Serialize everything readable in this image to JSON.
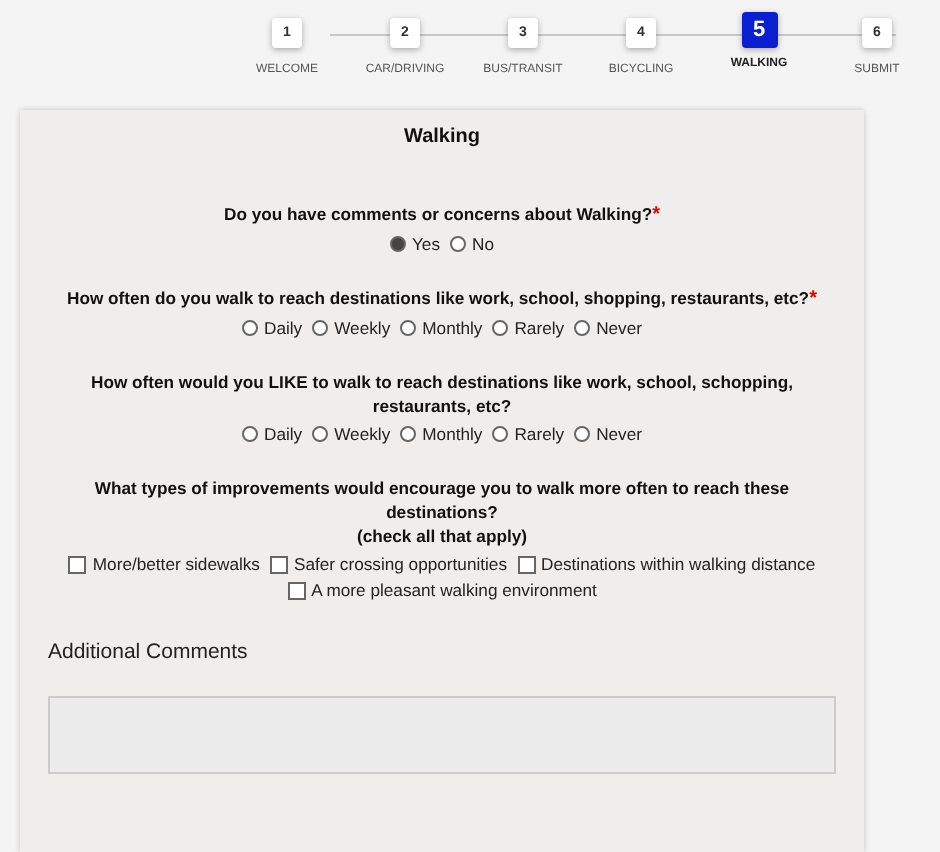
{
  "steps": [
    {
      "number": "1",
      "label": "WELCOME",
      "selected": false
    },
    {
      "number": "2",
      "label": "CAR/DRIVING",
      "selected": false
    },
    {
      "number": "3",
      "label": "BUS/TRANSIT",
      "selected": false
    },
    {
      "number": "4",
      "label": "BICYCLING",
      "selected": false
    },
    {
      "number": "5",
      "label": "WALKING",
      "selected": true
    },
    {
      "number": "6",
      "label": "SUBMIT",
      "selected": false
    }
  ],
  "form": {
    "title": "Walking",
    "questions": [
      {
        "kind": "radio",
        "label": "Do you have comments or concerns about Walking?",
        "required_mark": "*",
        "options": [
          {
            "label": "Yes",
            "selected": true
          },
          {
            "label": "No",
            "selected": false
          }
        ]
      },
      {
        "kind": "radio",
        "label": "How often do you walk to reach destinations like work, school, shopping, restaurants, etc?",
        "required_mark": "*",
        "options": [
          {
            "label": "Daily",
            "selected": false
          },
          {
            "label": "Weekly",
            "selected": false
          },
          {
            "label": "Monthly",
            "selected": false
          },
          {
            "label": "Rarely",
            "selected": false
          },
          {
            "label": "Never",
            "selected": false
          }
        ]
      },
      {
        "kind": "radio",
        "label": "How often would you LIKE to walk to reach destinations like work, school, schopping, restaurants, etc?",
        "options": [
          {
            "label": "Daily",
            "selected": false
          },
          {
            "label": "Weekly",
            "selected": false
          },
          {
            "label": "Monthly",
            "selected": false
          },
          {
            "label": "Rarely",
            "selected": false
          },
          {
            "label": "Never",
            "selected": false
          }
        ]
      },
      {
        "kind": "checkbox",
        "label": "What types of improvements would encourage you to walk more often to reach these destinations?",
        "note": "(check all that apply)",
        "options": [
          {
            "label": "More/better sidewalks",
            "checked": false
          },
          {
            "label": "Safer crossing opportunities",
            "checked": false
          },
          {
            "label": "Destinations within walking distance",
            "checked": false
          },
          {
            "label": "A more pleasant walking environment",
            "checked": false
          }
        ]
      }
    ],
    "comments": {
      "label": "Additional Comments"
    }
  }
}
